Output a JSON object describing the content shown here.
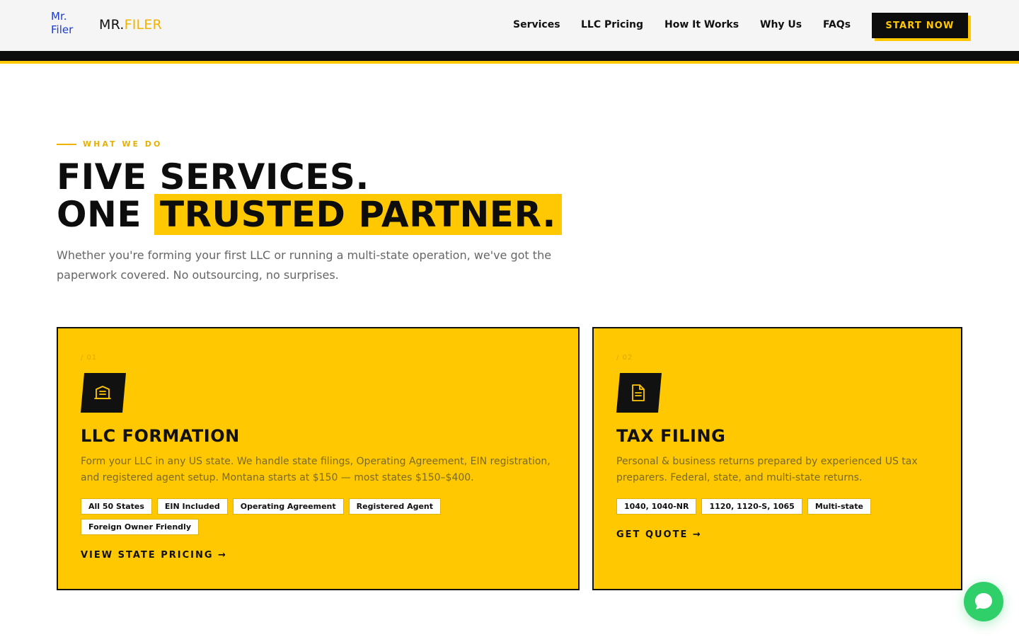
{
  "header": {
    "logo_alt": "Mr. Filer",
    "brand_prefix": "MR.",
    "brand_suffix": "FILER",
    "nav": [
      "Services",
      "LLC Pricing",
      "How It Works",
      "Why Us",
      "FAQs"
    ],
    "cta": "START NOW"
  },
  "hero": {
    "eyebrow": "WHAT WE DO",
    "headline_line1": "FIVE SERVICES.",
    "headline_line2_plain": "ONE",
    "headline_line2_highlight": "TRUSTED PARTNER.",
    "subtext": "Whether you're forming your first LLC or running a multi-state operation, we've got the paperwork covered. No outsourcing, no surprises."
  },
  "cards": [
    {
      "number": "/ 01",
      "icon": "building-icon",
      "title": "LLC FORMATION",
      "description": "Form your LLC in any US state. We handle state filings, Operating Agreement, EIN registration, and registered agent setup. Montana starts at $150 — most states $150–$400.",
      "tags": [
        "All 50 States",
        "EIN Included",
        "Operating Agreement",
        "Registered Agent",
        "Foreign Owner Friendly"
      ],
      "link": "VIEW STATE PRICING →"
    },
    {
      "number": "/ 02",
      "icon": "document-icon",
      "title": "TAX FILING",
      "description": "Personal & business returns prepared by experienced US tax preparers. Federal, state, and multi-state returns.",
      "tags": [
        "1040, 1040-NR",
        "1120, 1120-S, 1065",
        "Multi-state"
      ],
      "link": "GET QUOTE →"
    }
  ],
  "chat": {
    "icon": "chat-bubble-icon"
  },
  "colors": {
    "accent": "#ffc800",
    "dark": "#0d0d0d",
    "chat": "#2fcf6a"
  }
}
